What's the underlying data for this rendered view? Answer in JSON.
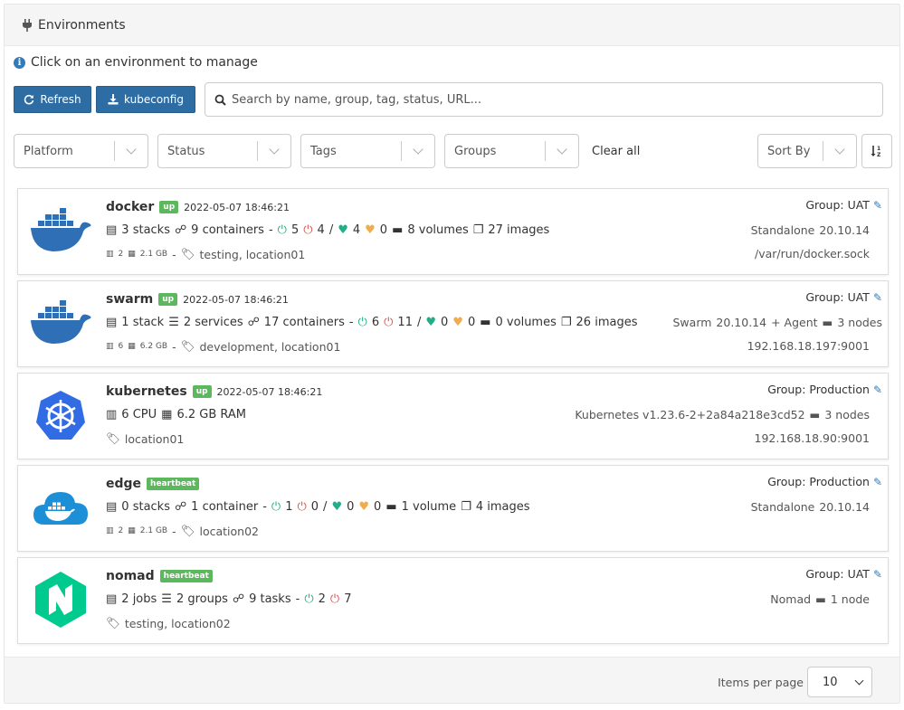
{
  "panel": {
    "title": "Environments"
  },
  "info": {
    "text": "Click on an environment to manage"
  },
  "toolbar": {
    "refresh_label": "Refresh",
    "kubeconfig_label": "kubeconfig"
  },
  "search": {
    "placeholder": "Search by name, group, tag, status, URL..."
  },
  "filters": {
    "platform": "Platform",
    "status": "Status",
    "tags": "Tags",
    "groups": "Groups",
    "clear_all": "Clear all",
    "sort_by": "Sort By"
  },
  "environments": [
    {
      "name": "docker",
      "badge": "up",
      "timestamp": "2022-05-07 18:46:21",
      "group": "Group: UAT",
      "row2": {
        "stacks": "3 stacks",
        "containers": "9 containers",
        "running": "5",
        "stopped": "4",
        "healthy": "4",
        "unhealthy": "0",
        "volumes": "8 volumes",
        "images": "27 images"
      },
      "cpu": "2",
      "mem": "2.1 GB",
      "tags": "testing, location01",
      "platform": "Standalone",
      "version": "20.10.14",
      "url": "/var/run/docker.sock"
    },
    {
      "name": "swarm",
      "badge": "up",
      "timestamp": "2022-05-07 18:46:21",
      "group": "Group: UAT",
      "row2": {
        "stacks": "1 stack",
        "services": "2 services",
        "containers": "17 containers",
        "running": "6",
        "stopped": "11",
        "healthy": "0",
        "unhealthy": "0",
        "volumes": "0 volumes",
        "images": "26 images"
      },
      "cpu": "6",
      "mem": "6.2 GB",
      "tags": "development, location01",
      "platform": "Swarm",
      "version": "20.10.14",
      "agent": "+ Agent",
      "nodes": "3 nodes",
      "url": "192.168.18.197:9001"
    },
    {
      "name": "kubernetes",
      "badge": "up",
      "timestamp": "2022-05-07 18:46:21",
      "group": "Group: Production",
      "row2": {
        "cpu": "6 CPU",
        "ram": "6.2 GB RAM"
      },
      "tags": "location01",
      "platform": "Kubernetes v1.23.6-2+2a84a218e3cd52",
      "nodes": "3 nodes",
      "url": "192.168.18.90:9001"
    },
    {
      "name": "edge",
      "badge": "heartbeat",
      "group": "Group: Production",
      "row2": {
        "stacks": "0 stacks",
        "containers": "1 container",
        "running": "1",
        "stopped": "0",
        "healthy": "0",
        "unhealthy": "0",
        "volumes": "1 volume",
        "images": "4 images"
      },
      "cpu": "2",
      "mem": "2.1 GB",
      "tags": "location02",
      "platform": "Standalone",
      "version": "20.10.14"
    },
    {
      "name": "nomad",
      "badge": "heartbeat",
      "group": "Group: UAT",
      "row2": {
        "jobs": "2 jobs",
        "groups": "2 groups",
        "tasks": "9 tasks",
        "running": "2",
        "stopped": "7"
      },
      "tags": "testing, location02",
      "platform": "Nomad",
      "nodes": "1 node"
    }
  ],
  "footer": {
    "items_per_page_label": "Items per page",
    "items_per_page_value": "10"
  },
  "colors": {
    "primary": "#2e6da4",
    "badge_green": "#5cb85c",
    "running": "#23ae89",
    "stopped": "#d9534f",
    "unhealthy": "#f0ad4e",
    "docker_blue": "#2f6fb5",
    "kube_blue": "#326ce5",
    "nomad_green": "#00ca8e"
  }
}
